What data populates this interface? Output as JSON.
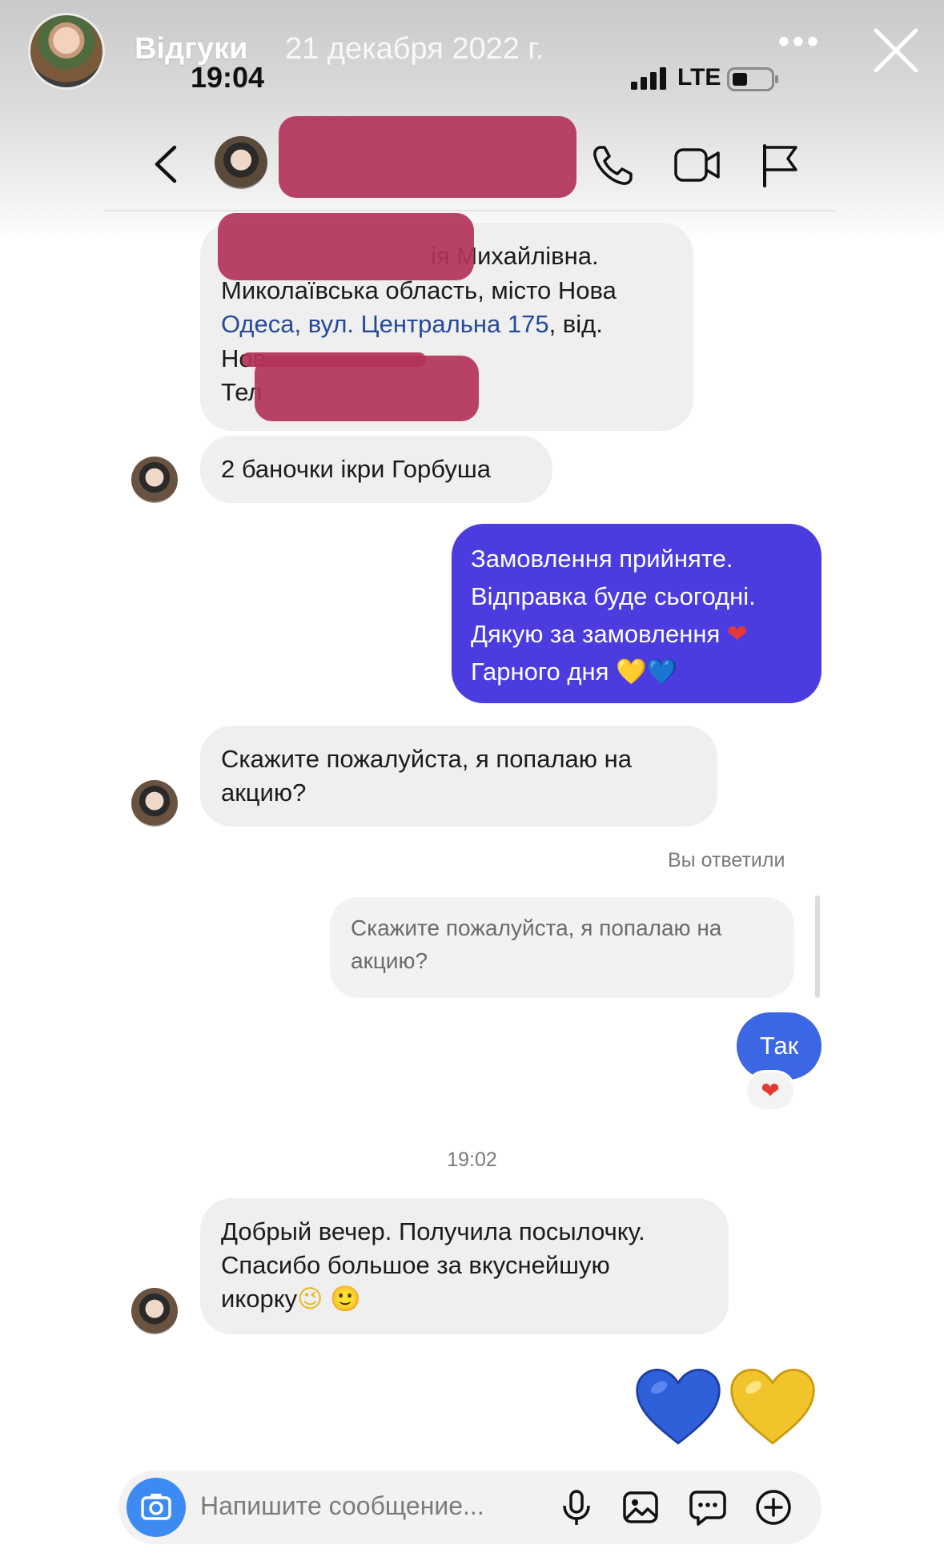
{
  "story": {
    "title": "Відгуки",
    "date": "21 декабря 2022 г.",
    "more_icon": "more-dots-icon",
    "close_icon": "close-icon"
  },
  "status_bar": {
    "time": "19:04",
    "network": "LTE"
  },
  "header": {
    "back_icon": "chevron-left-icon",
    "call_icon": "phone-icon",
    "video_icon": "video-camera-icon",
    "flag_icon": "flag-icon"
  },
  "messages": {
    "address": {
      "line1": "ія Михайлівна.",
      "line2": "Миколаївська область, місто Нова",
      "line3_link": "Одеса, вул. Центральна 175",
      "line3_rest": ", від.",
      "line4": "Нов",
      "line5": "Тел"
    },
    "order": "2 баночки ікри Горбуша",
    "sent_confirmation": {
      "line1": "Замовлення прийняте.",
      "line2": "Відправка буде сьогодні.",
      "line3": "Дякую за замовлення",
      "line4": "Гарного дня"
    },
    "question": {
      "line1": "Скажите пожалуйста,  я попалаю на",
      "line2": "акцию?"
    },
    "reply_label": "Вы ответили",
    "quoted": {
      "line1": "Скажите пожалуйста,  я попалаю на",
      "line2": "акцию?"
    },
    "answer": "Так",
    "timestamp": "19:02",
    "review": {
      "line1": "Добрый вечер. Получила посылочку.",
      "line2": "Спасибо большое за вкуснейшую",
      "line3": "икорку"
    }
  },
  "emoji": {
    "red_heart": "❤",
    "yellow_heart": "💛",
    "blue_heart": "💙",
    "wink": "😉",
    "smile": "🙂"
  },
  "composer": {
    "placeholder": "Напишите сообщение...",
    "camera_icon": "camera-icon",
    "mic_icon": "microphone-icon",
    "gallery_icon": "image-icon",
    "sticker_icon": "chat-bubble-icon",
    "add_icon": "plus-circle-icon"
  },
  "colors": {
    "sent_bubble": "#4a3cdf",
    "answer_bubble": "#3b67e4",
    "received_bubble": "#efefef",
    "redaction": "#b2335a",
    "camera_button": "#3d8bf2"
  }
}
